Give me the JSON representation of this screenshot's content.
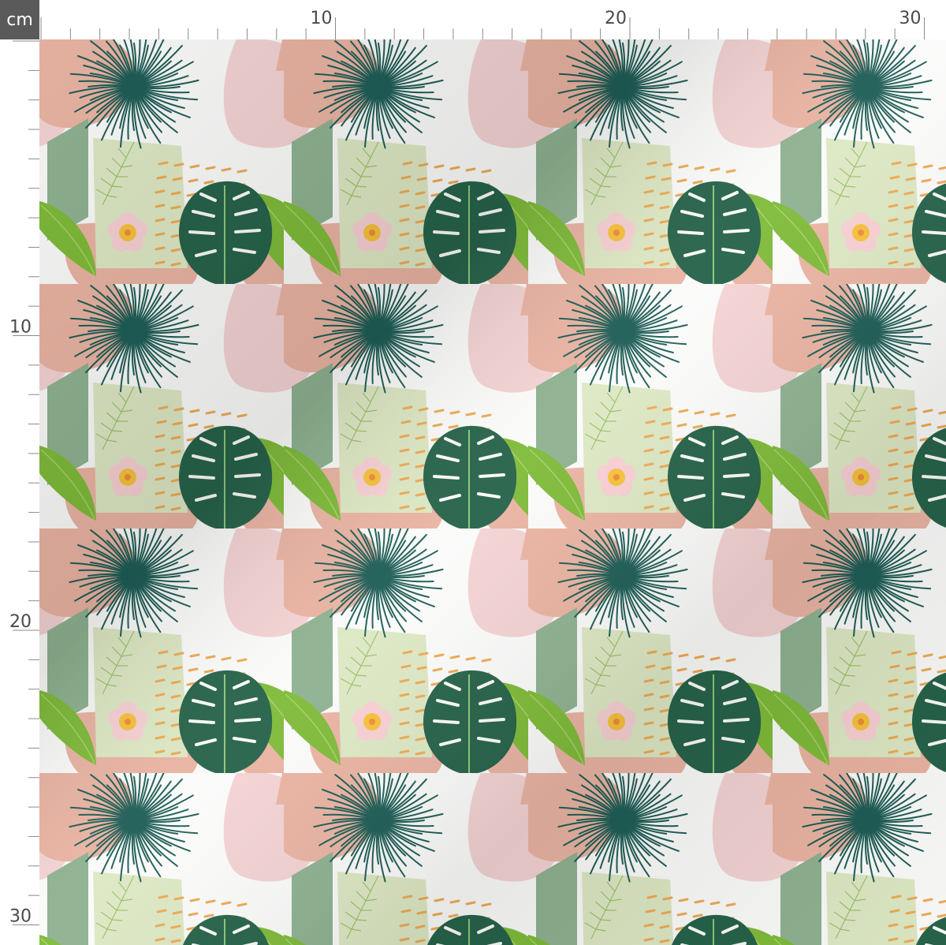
{
  "ruler": {
    "unit": "cm",
    "top_labels": [
      {
        "value": 10,
        "text": "10"
      },
      {
        "value": 20,
        "text": "20"
      },
      {
        "value": 30,
        "text": "30"
      }
    ],
    "left_labels": [
      {
        "value": 10,
        "text": "10"
      },
      {
        "value": 20,
        "text": "20"
      },
      {
        "value": 30,
        "text": "30"
      }
    ]
  },
  "pattern": {
    "motifs": [
      "palm-burst",
      "monstera-leaf",
      "banana-leaf",
      "hibiscus-flower",
      "fern-frond",
      "pink-blob",
      "sage-block",
      "dash-dots"
    ],
    "colors": {
      "background": "#fbfbfa",
      "blush_pink": "#f4d3d3",
      "salmon_pink": "#eab4a3",
      "sage_green": "#8fb291",
      "pale_green": "#dde8c4",
      "dark_teal": "#1f5e57",
      "monstera_green": "#27634a",
      "leaf_green": "#7fbb3a",
      "dash_orange": "#eeab55",
      "flower_pink": "#f8d0d3",
      "flower_yellow": "#f6c23d",
      "ruler_text": "#4a4a4a",
      "ruler_box": "#5a5a5a"
    }
  }
}
